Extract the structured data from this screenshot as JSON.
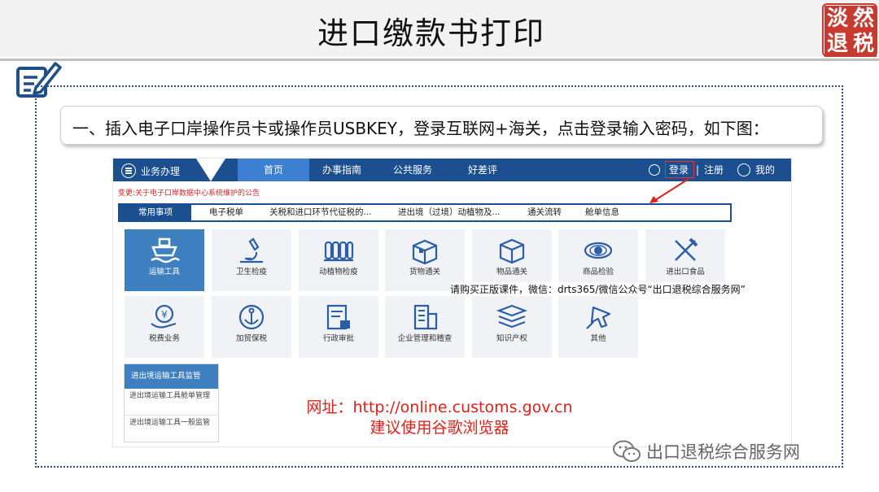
{
  "slide": {
    "title": "进口缴款书打印",
    "seal_chars": [
      "淡",
      "然",
      "退",
      "税"
    ],
    "instruction": "一、插入电子口岸操作员卡或操作员USBKEY，登录互联网+海关，点击登录输入密码，如下图：",
    "url_line": "网址：http://online.customs.gov.cn",
    "browser_line": "建议使用谷歌浏览器",
    "watermark": "出口退税综合服务网",
    "promo_text": "请购买正版课件，微信：drts365/微信公众号“出口退税综合服务网”"
  },
  "portal": {
    "topnav": {
      "business": "业务办理",
      "tabs": [
        "首页",
        "办事指南",
        "公共服务",
        "好差评"
      ],
      "login": "登录",
      "separator": "|",
      "register": "注册",
      "mine": "我的"
    },
    "notice": "变更:关于电子口岸数据中心系统维护的公告",
    "subnav": [
      "常用事项",
      "电子税单",
      "关税和进口环节代征税的...",
      "进出境（过境）动植物及...",
      "通关流转",
      "舱单信息"
    ],
    "tiles_row1": [
      "运输工具",
      "卫生检疫",
      "动植物检疫",
      "货物通关",
      "物品通关",
      "商品检验",
      "进出口食品"
    ],
    "tiles_row2": [
      "税费业务",
      "加贸保税",
      "行政审批",
      "企业管理和稽查",
      "知识产权",
      "其他"
    ],
    "sidecard": {
      "header": "进出境运输工具监管",
      "items": [
        "进出境运输工具舱单管理",
        "进出境运输工具一般监管"
      ]
    }
  },
  "colors": {
    "nav_blue": "#1b4f8f",
    "active_blue": "#3d7fbf",
    "accent_red": "#e0211b",
    "seal_red": "#c8392f",
    "frame_blue": "#2b4d82"
  }
}
